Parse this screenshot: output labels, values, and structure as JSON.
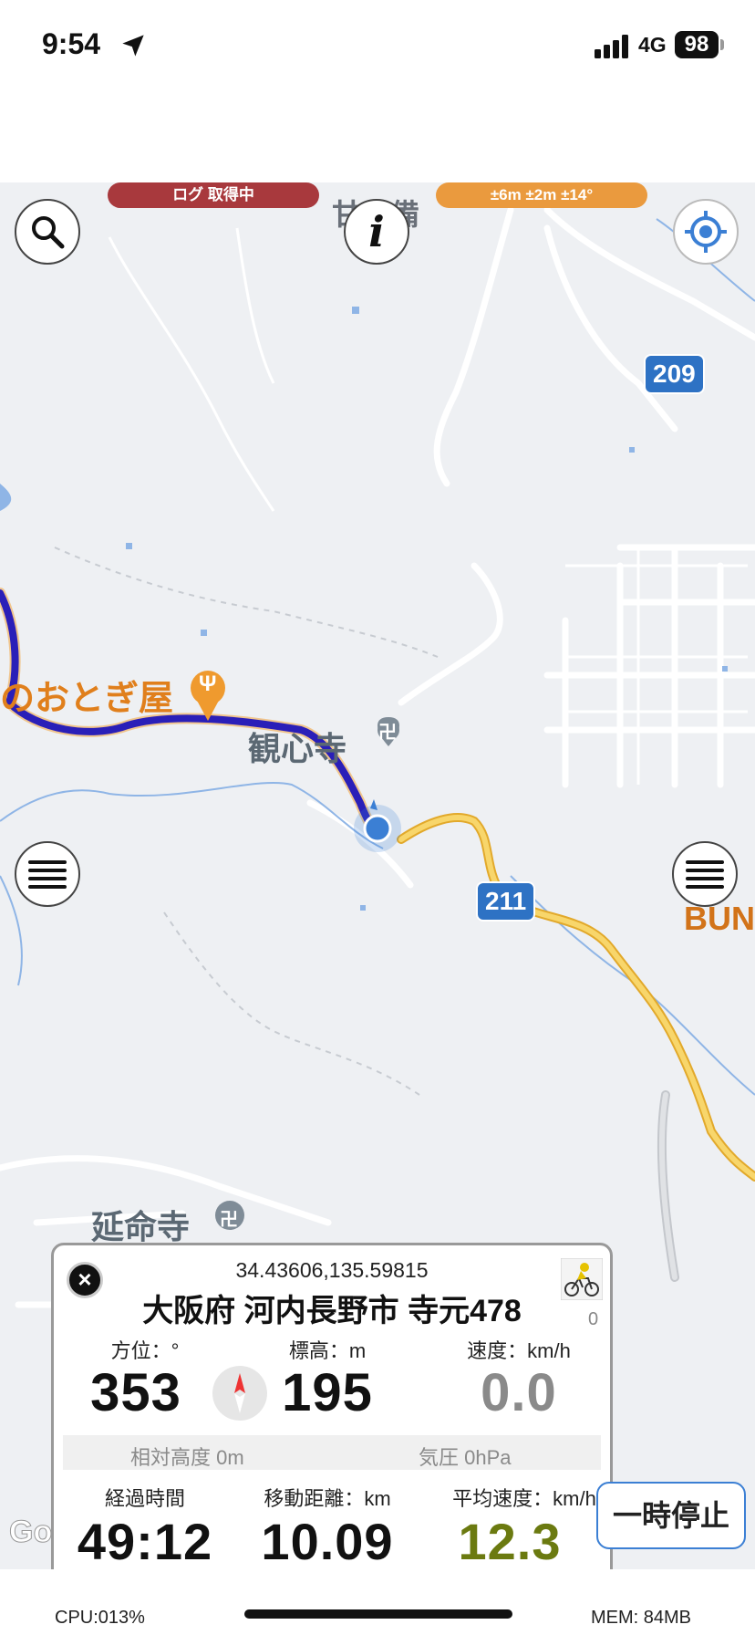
{
  "status_bar": {
    "time": "9:54",
    "network": "4G",
    "battery": "98"
  },
  "overlay": {
    "log_status": "ログ 取得中",
    "accuracy": "±6m ±2m ±14°"
  },
  "map": {
    "labels": {
      "top_place": "甘南備",
      "restaurant": "のおとぎ屋",
      "temple1": "観心寺",
      "temple2": "延命寺",
      "edge_label": "BUN"
    },
    "routes": [
      "209",
      "211"
    ],
    "attribution": "Go"
  },
  "panel": {
    "coords": "34.43606,135.59815",
    "address": "大阪府 河内長野市 寺元478",
    "activity_count": "0",
    "heading_label": "方位：°",
    "heading_value": "353",
    "altitude_label": "標高：m",
    "altitude_value": "195",
    "speed_label": "速度：km/h",
    "speed_value": "0.0",
    "relative_altitude": "相対高度 0m",
    "pressure": "気圧 0hPa",
    "elapsed_label": "経過時間",
    "elapsed_value": "49:12",
    "distance_label": "移動距離：km",
    "distance_value": "10.09",
    "avg_speed_label": "平均速度：km/h",
    "avg_speed_value": "12.3"
  },
  "pause_button": "一時停止",
  "footer": {
    "cpu": "CPU:013%",
    "mem": "MEM: 84MB"
  },
  "colors": {
    "track": "#2a1fb8",
    "route_road": "#f5c542",
    "accent_blue": "#3b7fd4",
    "avg_speed": "#6b7a10",
    "log_pill": "#a8393d",
    "accuracy_pill": "#ea9a3e"
  }
}
